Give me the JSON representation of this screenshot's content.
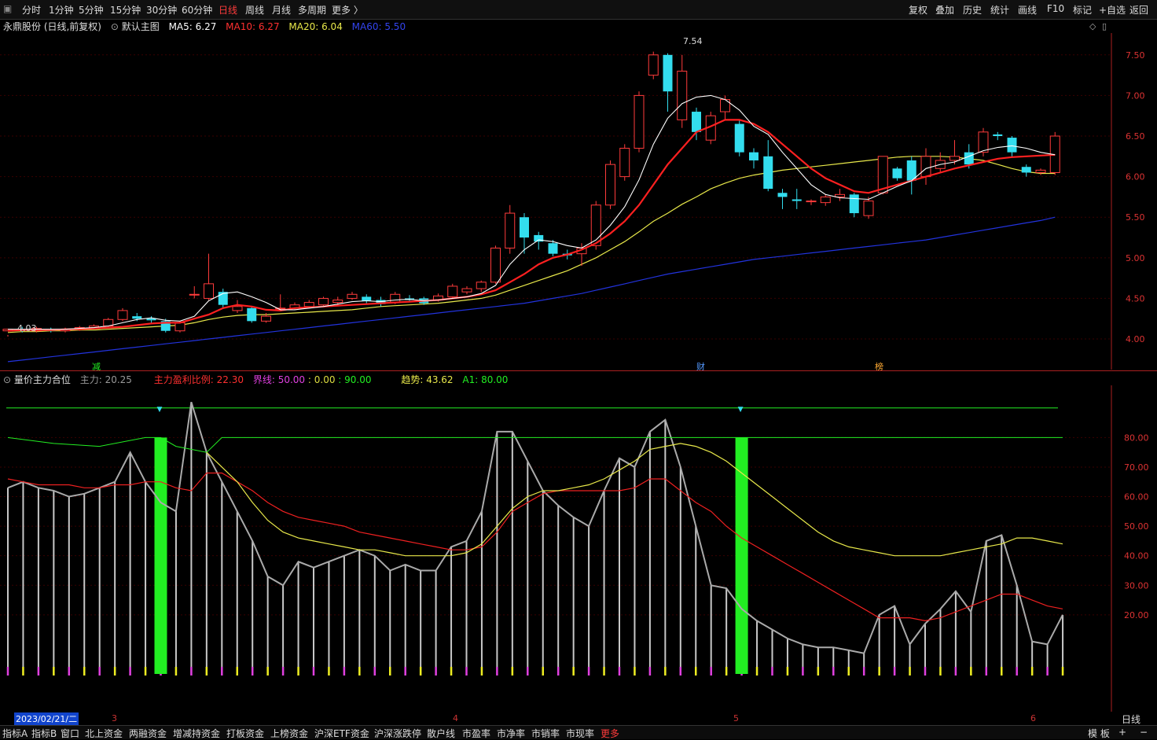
{
  "toolbar": {
    "periods": [
      "分时",
      "1分钟",
      "5分钟",
      "15分钟",
      "30分钟",
      "60分钟",
      "日线",
      "周线",
      "月线",
      "多周期",
      "更多 〉"
    ],
    "active": "日线",
    "right": [
      "复权",
      "叠加",
      "历史",
      "统计",
      "画线",
      "F10",
      "标记",
      "+自选",
      "返回"
    ]
  },
  "main_legend": {
    "stock": "永鼎股份 (日线,前复权)",
    "template": "默认主图",
    "ma5": "MA5: 6.27",
    "ma10": "MA10: 6.27",
    "ma20": "MA20: 6.04",
    "ma60": "MA60: 5.50"
  },
  "sub_legend": {
    "name": "量价主力合位",
    "zl": "主力: 20.25",
    "ratio": "主力盈利比例: 22.30",
    "jx_label": "界线:",
    "jx_vals": "50.00",
    "zero": ": 0.00",
    "ninety": ": 90.00",
    "trend": "趋势: 43.62",
    "a1": "A1: 80.00"
  },
  "annotations": {
    "high": "7.54",
    "low": "4.03",
    "mark1": "减",
    "mark2": "财",
    "mark3": "榜"
  },
  "colors": {
    "up": "#ff3b3b",
    "down": "#33ddee",
    "ma5": "#ffffff",
    "ma10": "#ff2020",
    "ma20": "#e8e84a",
    "ma60": "#2233dd",
    "green": "#22ee22"
  },
  "chart_data": [
    {
      "type": "candlestick",
      "title": "永鼎股份 (日线,前复权)",
      "yticks": [
        "7.50",
        "7.00",
        "6.50",
        "6.00",
        "5.50",
        "5.00",
        "4.50",
        "4.00"
      ],
      "ylim": [
        3.7,
        7.75
      ],
      "candles": [
        [
          4.1,
          4.12,
          4.05,
          4.03
        ],
        [
          4.12,
          4.1,
          4.15,
          4.08
        ],
        [
          4.1,
          4.13,
          4.15,
          4.08
        ],
        [
          4.12,
          4.1,
          4.14,
          4.08
        ],
        [
          4.1,
          4.12,
          4.14,
          4.08
        ],
        [
          4.12,
          4.14,
          4.16,
          4.1
        ],
        [
          4.14,
          4.16,
          4.18,
          4.12
        ],
        [
          4.16,
          4.24,
          4.26,
          4.14
        ],
        [
          4.24,
          4.35,
          4.38,
          4.22
        ],
        [
          4.28,
          4.25,
          4.32,
          4.22
        ],
        [
          4.25,
          4.23,
          4.28,
          4.2
        ],
        [
          4.22,
          4.1,
          4.25,
          4.08
        ],
        [
          4.1,
          4.2,
          4.22,
          4.08
        ],
        [
          4.55,
          4.55,
          4.65,
          4.5
        ],
        [
          4.5,
          4.68,
          5.05,
          4.48
        ],
        [
          4.58,
          4.42,
          4.62,
          4.38
        ],
        [
          4.35,
          4.4,
          4.48,
          4.32
        ],
        [
          4.38,
          4.22,
          4.4,
          4.2
        ],
        [
          4.22,
          4.28,
          4.32,
          4.2
        ],
        [
          4.38,
          4.38,
          4.55,
          4.35
        ],
        [
          4.38,
          4.42,
          4.45,
          4.36
        ],
        [
          4.4,
          4.45,
          4.48,
          4.38
        ],
        [
          4.42,
          4.5,
          4.52,
          4.4
        ],
        [
          4.45,
          4.48,
          4.52,
          4.42
        ],
        [
          4.5,
          4.55,
          4.58,
          4.48
        ],
        [
          4.52,
          4.47,
          4.55,
          4.44
        ],
        [
          4.48,
          4.43,
          4.52,
          4.4
        ],
        [
          4.45,
          4.55,
          4.58,
          4.43
        ],
        [
          4.5,
          4.48,
          4.54,
          4.46
        ],
        [
          4.5,
          4.44,
          4.52,
          4.42
        ],
        [
          4.48,
          4.53,
          4.56,
          4.46
        ],
        [
          4.52,
          4.65,
          4.68,
          4.5
        ],
        [
          4.58,
          4.62,
          4.65,
          4.55
        ],
        [
          4.62,
          4.7,
          4.72,
          4.58
        ],
        [
          4.7,
          5.12,
          5.15,
          4.68
        ],
        [
          5.12,
          5.55,
          5.65,
          5.05
        ],
        [
          5.5,
          5.25,
          5.55,
          5.05
        ],
        [
          5.28,
          5.2,
          5.32,
          5.1
        ],
        [
          5.18,
          5.05,
          5.22,
          5.02
        ],
        [
          5.05,
          5.03,
          5.1,
          4.98
        ],
        [
          5.05,
          5.12,
          5.18,
          4.9
        ],
        [
          5.15,
          5.65,
          5.7,
          5.1
        ],
        [
          5.65,
          6.15,
          6.2,
          5.6
        ],
        [
          6.0,
          6.35,
          6.4,
          5.95
        ],
        [
          6.35,
          7.0,
          7.05,
          6.3
        ],
        [
          7.25,
          7.5,
          7.54,
          7.2
        ],
        [
          7.5,
          7.05,
          7.52,
          6.8
        ],
        [
          6.7,
          7.3,
          7.5,
          6.6
        ],
        [
          6.8,
          6.55,
          6.85,
          6.45
        ],
        [
          6.45,
          6.75,
          6.8,
          6.4
        ],
        [
          6.8,
          6.95,
          7.0,
          6.7
        ],
        [
          6.65,
          6.3,
          6.7,
          6.25
        ],
        [
          6.3,
          6.2,
          6.35,
          6.1
        ],
        [
          6.25,
          5.85,
          6.45,
          5.82
        ],
        [
          5.8,
          5.75,
          5.85,
          5.6
        ],
        [
          5.72,
          5.7,
          5.85,
          5.6
        ],
        [
          5.7,
          5.7,
          5.72,
          5.65
        ],
        [
          5.68,
          5.75,
          5.78,
          5.64
        ],
        [
          5.75,
          5.78,
          5.85,
          5.7
        ],
        [
          5.78,
          5.55,
          5.8,
          5.5
        ],
        [
          5.52,
          5.7,
          5.75,
          5.48
        ],
        [
          5.8,
          6.25,
          6.25,
          5.78
        ],
        [
          6.1,
          5.98,
          6.12,
          5.95
        ],
        [
          6.2,
          5.95,
          6.25,
          5.78
        ],
        [
          6.0,
          6.25,
          6.35,
          5.9
        ],
        [
          6.1,
          6.2,
          6.3,
          6.05
        ],
        [
          6.2,
          6.25,
          6.45,
          6.15
        ],
        [
          6.3,
          6.15,
          6.4,
          6.1
        ],
        [
          6.3,
          6.55,
          6.6,
          6.25
        ],
        [
          6.52,
          6.5,
          6.55,
          6.45
        ],
        [
          6.48,
          6.3,
          6.5,
          6.25
        ],
        [
          6.12,
          6.05,
          6.15,
          6.0
        ],
        [
          6.05,
          6.08,
          6.1,
          6.02
        ],
        [
          6.05,
          6.5,
          6.55,
          6.02
        ]
      ],
      "ma5": [
        4.12,
        4.12,
        4.12,
        4.12,
        4.12,
        4.13,
        4.14,
        4.16,
        4.2,
        4.24,
        4.26,
        4.23,
        4.22,
        4.28,
        4.47,
        4.56,
        4.58,
        4.52,
        4.45,
        4.36,
        4.36,
        4.38,
        4.4,
        4.43,
        4.46,
        4.47,
        4.46,
        4.48,
        4.49,
        4.47,
        4.48,
        4.5,
        4.52,
        4.56,
        4.66,
        4.92,
        5.1,
        5.22,
        5.2,
        5.15,
        5.12,
        5.22,
        5.4,
        5.63,
        5.96,
        6.4,
        6.72,
        6.9,
        6.98,
        7.0,
        6.95,
        6.82,
        6.62,
        6.52,
        6.3,
        6.1,
        5.9,
        5.78,
        5.74,
        5.73,
        5.72,
        5.8,
        5.88,
        5.95,
        6.1,
        6.15,
        6.18,
        6.25,
        6.32,
        6.36,
        6.38,
        6.35,
        6.3,
        6.27
      ],
      "ma10": [
        4.1,
        4.11,
        4.11,
        4.11,
        4.12,
        4.12,
        4.13,
        4.14,
        4.15,
        4.17,
        4.19,
        4.2,
        4.2,
        4.25,
        4.3,
        4.38,
        4.42,
        4.4,
        4.36,
        4.35,
        4.38,
        4.39,
        4.4,
        4.41,
        4.42,
        4.43,
        4.44,
        4.45,
        4.46,
        4.47,
        4.48,
        4.5,
        4.52,
        4.55,
        4.6,
        4.7,
        4.8,
        4.92,
        5.0,
        5.04,
        5.1,
        5.18,
        5.3,
        5.45,
        5.65,
        5.9,
        6.15,
        6.35,
        6.55,
        6.62,
        6.7,
        6.7,
        6.65,
        6.55,
        6.4,
        6.25,
        6.1,
        5.98,
        5.9,
        5.82,
        5.8,
        5.85,
        5.9,
        5.95,
        6.0,
        6.05,
        6.1,
        6.14,
        6.18,
        6.22,
        6.24,
        6.25,
        6.26,
        6.27
      ],
      "ma20": [
        4.08,
        4.09,
        4.09,
        4.1,
        4.1,
        4.11,
        4.11,
        4.12,
        4.13,
        4.14,
        4.15,
        4.16,
        4.17,
        4.2,
        4.24,
        4.27,
        4.29,
        4.3,
        4.3,
        4.31,
        4.32,
        4.33,
        4.34,
        4.35,
        4.36,
        4.38,
        4.4,
        4.41,
        4.42,
        4.43,
        4.44,
        4.46,
        4.48,
        4.5,
        4.54,
        4.6,
        4.66,
        4.72,
        4.78,
        4.84,
        4.92,
        5.0,
        5.1,
        5.2,
        5.32,
        5.45,
        5.55,
        5.66,
        5.75,
        5.85,
        5.92,
        5.98,
        6.02,
        6.05,
        6.08,
        6.1,
        6.12,
        6.14,
        6.16,
        6.18,
        6.2,
        6.22,
        6.24,
        6.25,
        6.25,
        6.25,
        6.24,
        6.22,
        6.2,
        6.15,
        6.1,
        6.06,
        6.04,
        6.04
      ],
      "ma60": [
        3.72,
        3.74,
        3.76,
        3.78,
        3.8,
        3.82,
        3.84,
        3.86,
        3.88,
        3.9,
        3.92,
        3.94,
        3.96,
        3.98,
        4.0,
        4.02,
        4.04,
        4.06,
        4.08,
        4.1,
        4.12,
        4.14,
        4.16,
        4.18,
        4.2,
        4.22,
        4.24,
        4.26,
        4.28,
        4.3,
        4.32,
        4.34,
        4.36,
        4.38,
        4.4,
        4.42,
        4.44,
        4.47,
        4.5,
        4.53,
        4.56,
        4.6,
        4.64,
        4.68,
        4.72,
        4.76,
        4.8,
        4.83,
        4.86,
        4.89,
        4.92,
        4.95,
        4.98,
        5.0,
        5.02,
        5.04,
        5.06,
        5.08,
        5.1,
        5.12,
        5.14,
        5.16,
        5.18,
        5.2,
        5.22,
        5.25,
        5.28,
        5.31,
        5.34,
        5.37,
        5.4,
        5.43,
        5.46,
        5.5
      ]
    },
    {
      "type": "line",
      "title": "量价主力合位",
      "yticks": [
        "80.00",
        "70.00",
        "60.00",
        "50.00",
        "40.00",
        "30.00",
        "20.00"
      ],
      "ylim": [
        0,
        95
      ],
      "main": [
        63,
        65,
        63,
        62,
        60,
        61,
        63,
        65,
        75,
        65,
        58,
        55,
        92,
        75,
        65,
        55,
        45,
        33,
        30,
        38,
        36,
        38,
        40,
        42,
        40,
        35,
        37,
        35,
        35,
        43,
        45,
        55,
        82,
        82,
        72,
        62,
        57,
        53,
        50,
        62,
        73,
        70,
        82,
        86,
        70,
        50,
        30,
        29,
        22,
        18,
        15,
        12,
        10,
        9,
        9,
        8,
        7,
        20,
        23,
        10,
        17,
        22,
        28,
        21,
        45,
        47,
        30,
        11,
        10,
        20
      ],
      "ma_red": [
        66,
        65,
        64,
        64,
        64,
        63,
        63,
        64,
        64,
        65,
        65,
        63,
        62,
        68,
        68,
        65,
        62,
        58,
        55,
        53,
        52,
        51,
        50,
        48,
        47,
        46,
        45,
        44,
        43,
        42,
        42,
        43,
        48,
        55,
        58,
        61,
        62,
        62,
        62,
        62,
        62,
        63,
        66,
        66,
        62,
        58,
        55,
        50,
        46,
        43,
        40,
        37,
        34,
        31,
        28,
        25,
        22,
        19,
        19,
        19,
        18,
        19,
        21,
        23,
        25,
        27,
        27,
        25,
        23,
        22
      ],
      "ma_yellow": [
        null,
        null,
        null,
        null,
        null,
        null,
        null,
        null,
        null,
        null,
        null,
        null,
        null,
        75,
        70,
        65,
        58,
        52,
        48,
        46,
        45,
        44,
        43,
        42,
        42,
        41,
        40,
        40,
        40,
        40,
        41,
        44,
        50,
        56,
        60,
        62,
        62,
        63,
        64,
        66,
        69,
        72,
        76,
        77,
        78,
        77,
        75,
        72,
        68,
        64,
        60,
        56,
        52,
        48,
        45,
        43,
        42,
        41,
        40,
        40,
        40,
        40,
        41,
        42,
        43,
        44,
        46,
        46,
        45,
        44
      ],
      "green_bars_at": [
        10,
        48
      ]
    }
  ],
  "dates": {
    "current": "2023/02/21/二",
    "months": [
      "3",
      "4",
      "5",
      "6"
    ],
    "period_label": "日线"
  },
  "bottombar": {
    "items": [
      "指标A",
      "指标B",
      "窗口",
      "北上资金",
      "两融资金",
      "增减持资金",
      "打板资金",
      "上榜资金",
      "沪深ETF资金",
      "沪深涨跌停",
      "散户线",
      "市盈率",
      "市净率",
      "市销率",
      "市现率",
      "更多"
    ],
    "right": [
      "模 板",
      "+",
      "−"
    ]
  }
}
